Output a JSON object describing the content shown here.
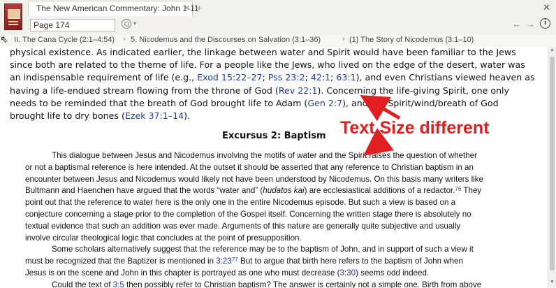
{
  "header": {
    "tab_title": "The New American Commentary: John 1-11",
    "tab_close": "✕",
    "tab_add": "+",
    "window_close": "✕",
    "reference_value": "Page 174",
    "sync_caret": "▾",
    "nav_back": "←",
    "nav_forward": "→",
    "info_label": "i"
  },
  "breadcrumb": {
    "menu_icon": "⁞",
    "items": [
      "II. The Cana Cycle (2:1–4:54)",
      "5. Nicodemus and the Discourses on Salvation (3:1–36)",
      "(1) The Story of Nicodemus (3:1–10)"
    ],
    "separator": "›"
  },
  "main": {
    "lines": [
      [
        {
          "t": "physical existence. As indicated earlier, the linkage between water and Spirit would have been familiar to the Jews"
        }
      ],
      [
        {
          "t": "since both are related to the theme of life. For a people like the Jews, who lived on the edge of the desert, water was"
        }
      ],
      [
        {
          "t": "an indispensable requirement of life (e.g., "
        },
        {
          "t": "Exod 15:22–27",
          "ref": true
        },
        {
          "t": "; "
        },
        {
          "t": "Pss 23:2",
          "ref": true
        },
        {
          "t": "; "
        },
        {
          "t": "42:1",
          "ref": true
        },
        {
          "t": "; "
        },
        {
          "t": "63:1",
          "ref": true
        },
        {
          "t": "), and even Christians viewed heaven as"
        }
      ],
      [
        {
          "t": "having a life-endued stream flowing from the throne of God ("
        },
        {
          "t": "Rev 22:1",
          "ref": true
        },
        {
          "t": "). Concerning the life-giving Spirit, one only"
        }
      ],
      [
        {
          "t": "needs to be reminded that the breath of God brought life to Adam ("
        },
        {
          "t": "Gen 2:7",
          "ref": true
        },
        {
          "t": "), and the Spirit/wind/breath of God"
        }
      ],
      [
        {
          "t": "brought life to dry bones ("
        },
        {
          "t": "Ezek 37:1–14",
          "ref": true
        },
        {
          "t": ")."
        }
      ]
    ],
    "excursus_title": "Excursus 2: Baptism",
    "excursus_lines": [
      [
        {
          "t": "This dialogue between Jesus and Nicodemus involving the motifs of water and the Spirit raises the question of whether"
        }
      ],
      [
        {
          "t": "or not a baptismal reference is here intended. At the outset it should be asserted that any reference to Christian baptism in an"
        }
      ],
      [
        {
          "t": "encounter between Jesus and Nicodemus would likely not have been understood by Nicodemus. On this basis many writers like"
        }
      ],
      [
        {
          "t": "Bultmann and Haenchen have argued that the words “water and” ("
        },
        {
          "t": "hudatos kai",
          "i": true
        },
        {
          "t": ") are ecclesiastical additions of a redactor."
        },
        {
          "t": "76",
          "fn": true
        },
        {
          "t": " They"
        }
      ],
      [
        {
          "t": "point out that the reference to water here is the only one in the entire Nicodemus episode. But such a view is based on a"
        }
      ],
      [
        {
          "t": "conjecture concerning a stage prior to the completion of the Gospel itself. Concerning the written stage there is absolutely no"
        }
      ],
      [
        {
          "t": "textual evidence that such an addition was ever made. Arguments of this nature are generally quite subjective and usually"
        }
      ],
      [
        {
          "t": "involve circular theological logic that concludes at the point of presupposition."
        }
      ],
      [
        {
          "t": "Some scholars alternatively suggest that the reference may be to the baptism of John, and in support of such a view it"
        }
      ],
      [
        {
          "t": "must be recognized that the Baptizer is mentioned in "
        },
        {
          "t": "3:23",
          "ref": true
        },
        {
          "t": "77",
          "fn": true
        },
        {
          "t": " But to argue that birth here refers to the baptism of John when"
        }
      ],
      [
        {
          "t": "Jesus is on the scene and John in this chapter is portrayed as one who must decrease ("
        },
        {
          "t": "3:30",
          "ref": true
        },
        {
          "t": ") seems odd indeed."
        }
      ],
      [
        {
          "t": "Could the text of "
        },
        {
          "t": "3:5",
          "ref": true
        },
        {
          "t": " then possibly refer to Christian baptism? The answer is certainly not a simple one. Birth from above"
        }
      ]
    ]
  },
  "annotation": {
    "text": "Text Size different",
    "color": "#e02020"
  },
  "scrollbar": {
    "up": "▲",
    "down": "▼"
  },
  "colors": {
    "link": "#1f3d99",
    "annotation": "#e02020"
  },
  "cursor_icon": "⇖"
}
